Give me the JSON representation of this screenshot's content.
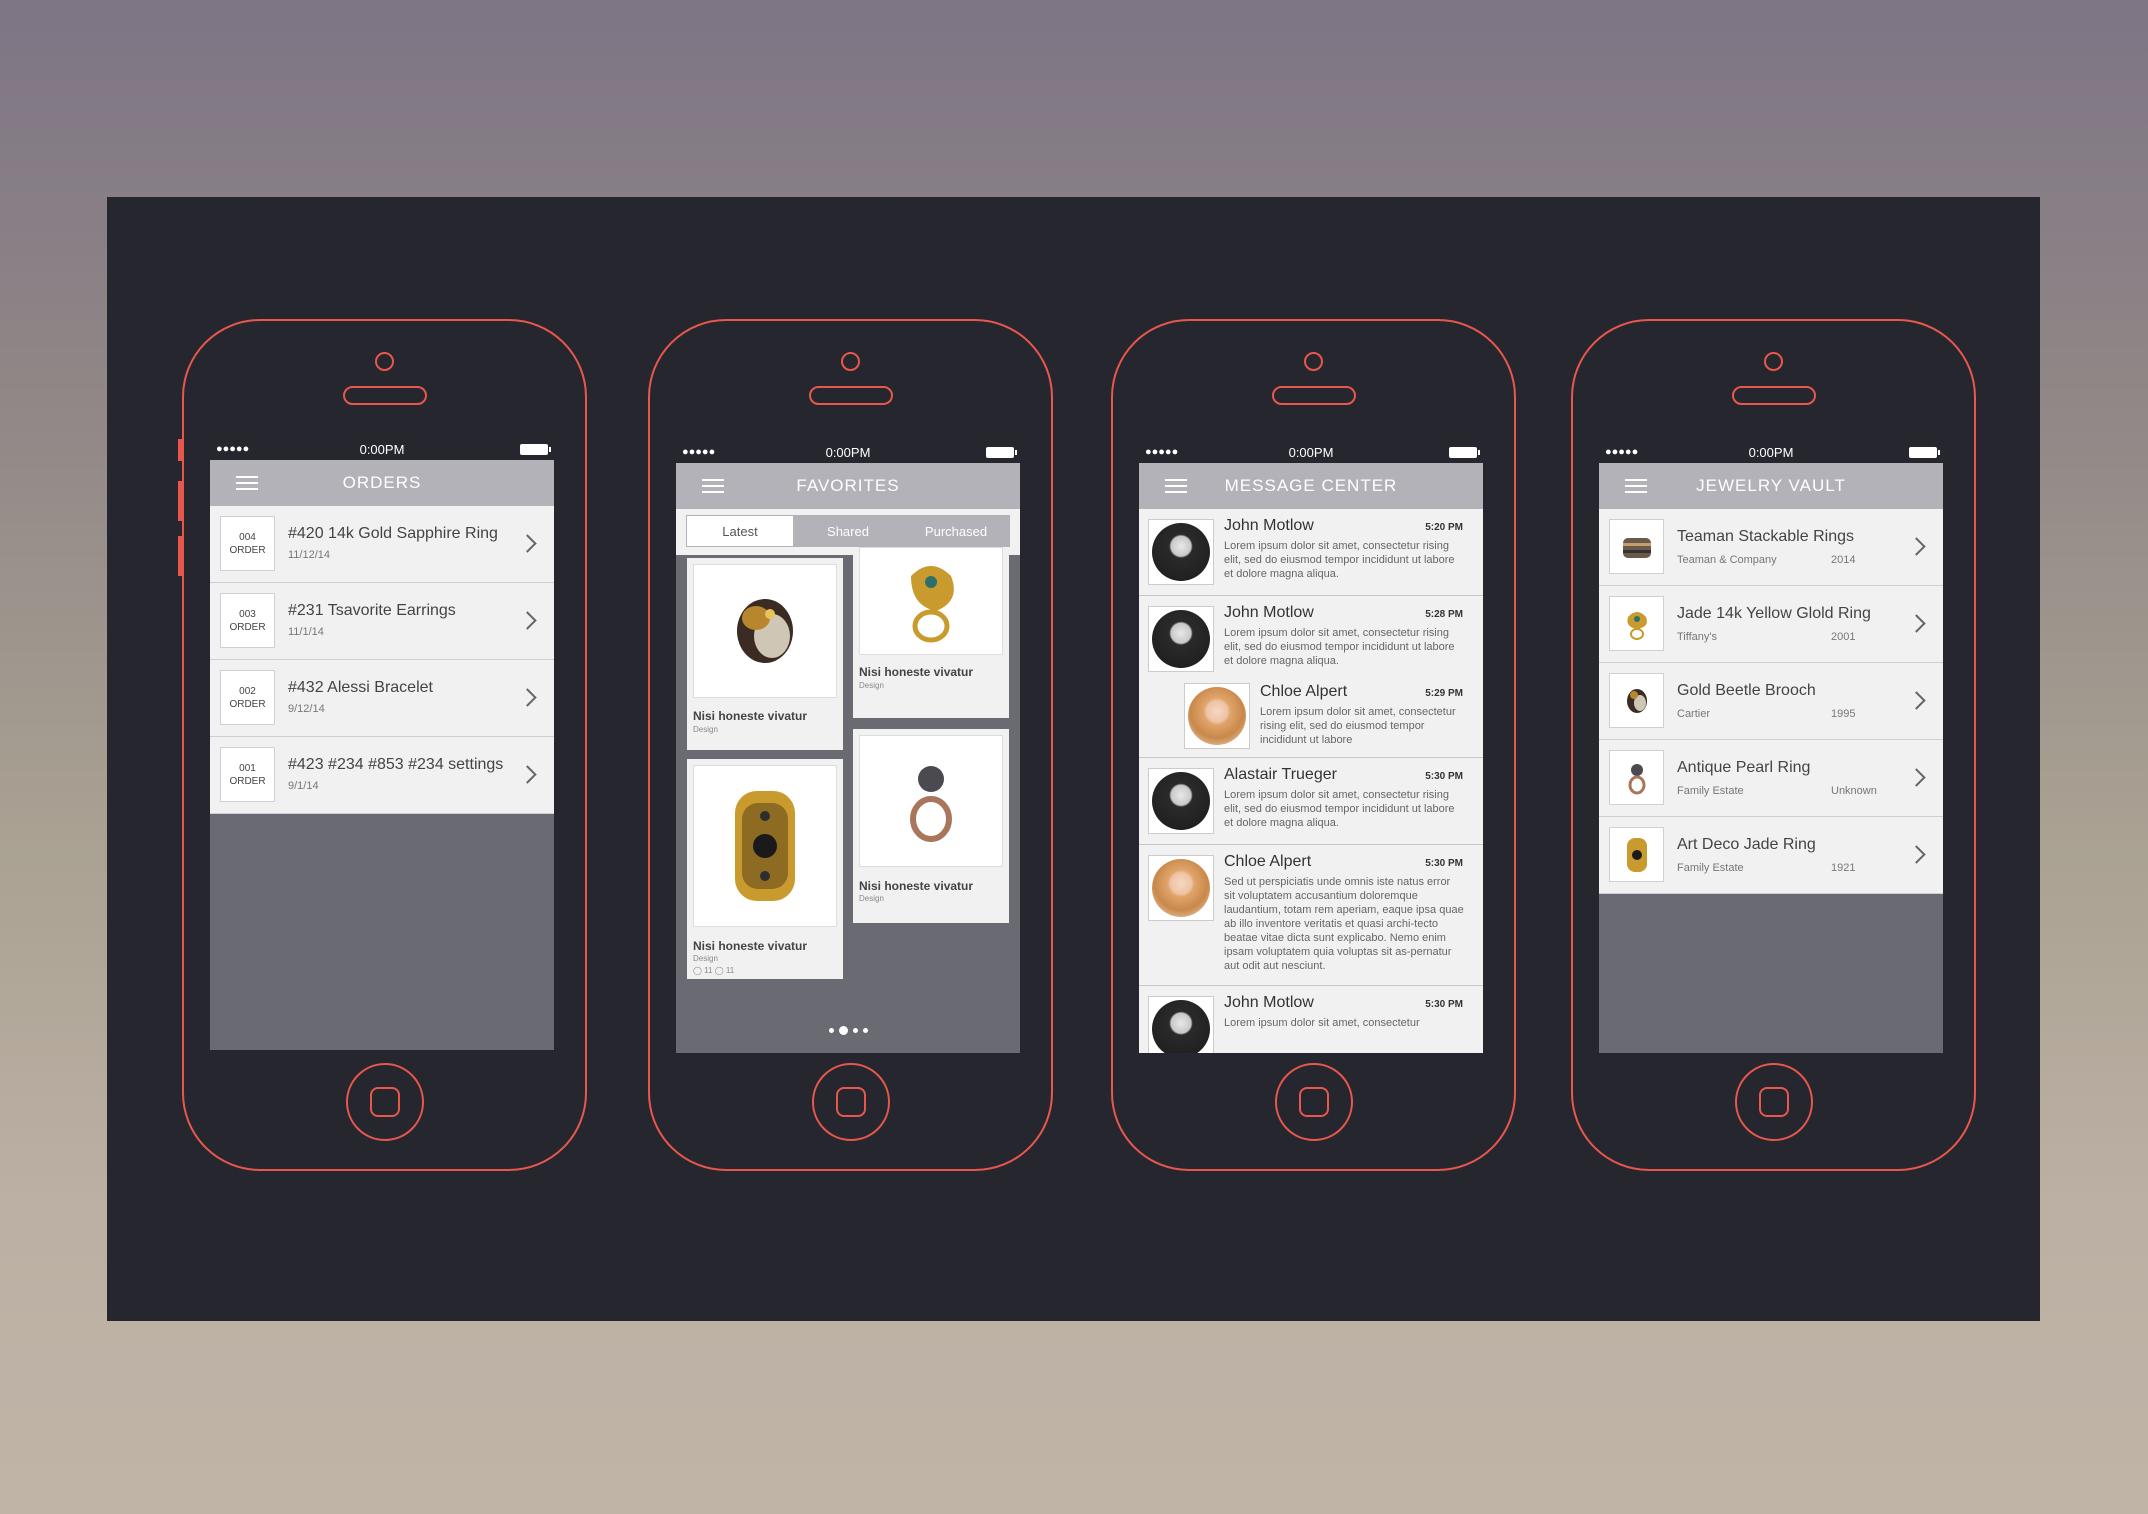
{
  "status": {
    "signal": "●●●●●",
    "time": "0:00PM"
  },
  "orders": {
    "title": "ORDERS",
    "items": [
      {
        "num": "004",
        "label": "ORDER",
        "title": "#420 14k Gold Sapphire Ring",
        "date": "11/12/14"
      },
      {
        "num": "003",
        "label": "ORDER",
        "title": "#231 Tsavorite Earrings",
        "date": "11/1/14"
      },
      {
        "num": "002",
        "label": "ORDER",
        "title": "#432 Alessi Bracelet",
        "date": "9/12/14"
      },
      {
        "num": "001",
        "label": "ORDER",
        "title": "#423 #234 #853 #234 settings",
        "date": "9/1/14"
      }
    ]
  },
  "favorites": {
    "title": "FAVORITES",
    "tabs": [
      "Latest",
      "Shared",
      "Purchased"
    ],
    "cards": [
      {
        "title": "Nisi honeste vivatur",
        "sub": "Design"
      },
      {
        "title": "Nisi honeste vivatur",
        "sub": "Design"
      },
      {
        "title": "Nisi honeste vivatur",
        "sub": "Design",
        "meta": "◯ 11  ◯ 11"
      },
      {
        "title": "Nisi honeste vivatur",
        "sub": "Design"
      }
    ]
  },
  "messages": {
    "title": "MESSAGE CENTER",
    "items": [
      {
        "name": "John Motlow",
        "time": "5:20 PM",
        "body": "Lorem ipsum dolor sit amet, consectetur rising elit, sed do eiusmod tempor incididunt ut labore et dolore magna aliqua."
      },
      {
        "name": "John Motlow",
        "time": "5:28 PM",
        "body": "Lorem ipsum dolor sit amet, consectetur rising elit, sed do eiusmod tempor incididunt ut labore et dolore magna aliqua."
      },
      {
        "name": "Chloe Alpert",
        "time": "5:29 PM",
        "body": "Lorem ipsum dolor sit amet, consectetur rising elit, sed do eiusmod tempor incididunt ut labore"
      },
      {
        "name": "Alastair Trueger",
        "time": "5:30 PM",
        "body": "Lorem ipsum dolor sit amet, consectetur rising elit, sed do eiusmod tempor incididunt ut labore et dolore magna aliqua."
      },
      {
        "name": "Chloe Alpert",
        "time": "5:30 PM",
        "body": "Sed ut perspiciatis unde omnis iste natus error sit voluptatem accusantium doloremque laudantium, totam rem aperiam, eaque ipsa quae ab illo inventore veritatis et quasi archi-tecto beatae vitae dicta sunt explicabo. Nemo enim ipsam voluptatem quia voluptas sit as-pernatur aut odit aut nesciunt."
      },
      {
        "name": "John Motlow",
        "time": "5:30 PM",
        "body": "Lorem ipsum dolor sit amet, consectetur"
      }
    ]
  },
  "vault": {
    "title": "JEWELRY VAULT",
    "items": [
      {
        "title": "Teaman Stackable Rings",
        "maker": "Teaman & Company",
        "year": "2014"
      },
      {
        "title": "Jade 14k Yellow Glold Ring",
        "maker": "Tiffany's",
        "year": "2001"
      },
      {
        "title": "Gold Beetle Brooch",
        "maker": "Cartier",
        "year": "1995"
      },
      {
        "title": "Antique Pearl Ring",
        "maker": "Family Estate",
        "year": "Unknown"
      },
      {
        "title": "Art Deco Jade Ring",
        "maker": "Family Estate",
        "year": "1921"
      }
    ]
  }
}
